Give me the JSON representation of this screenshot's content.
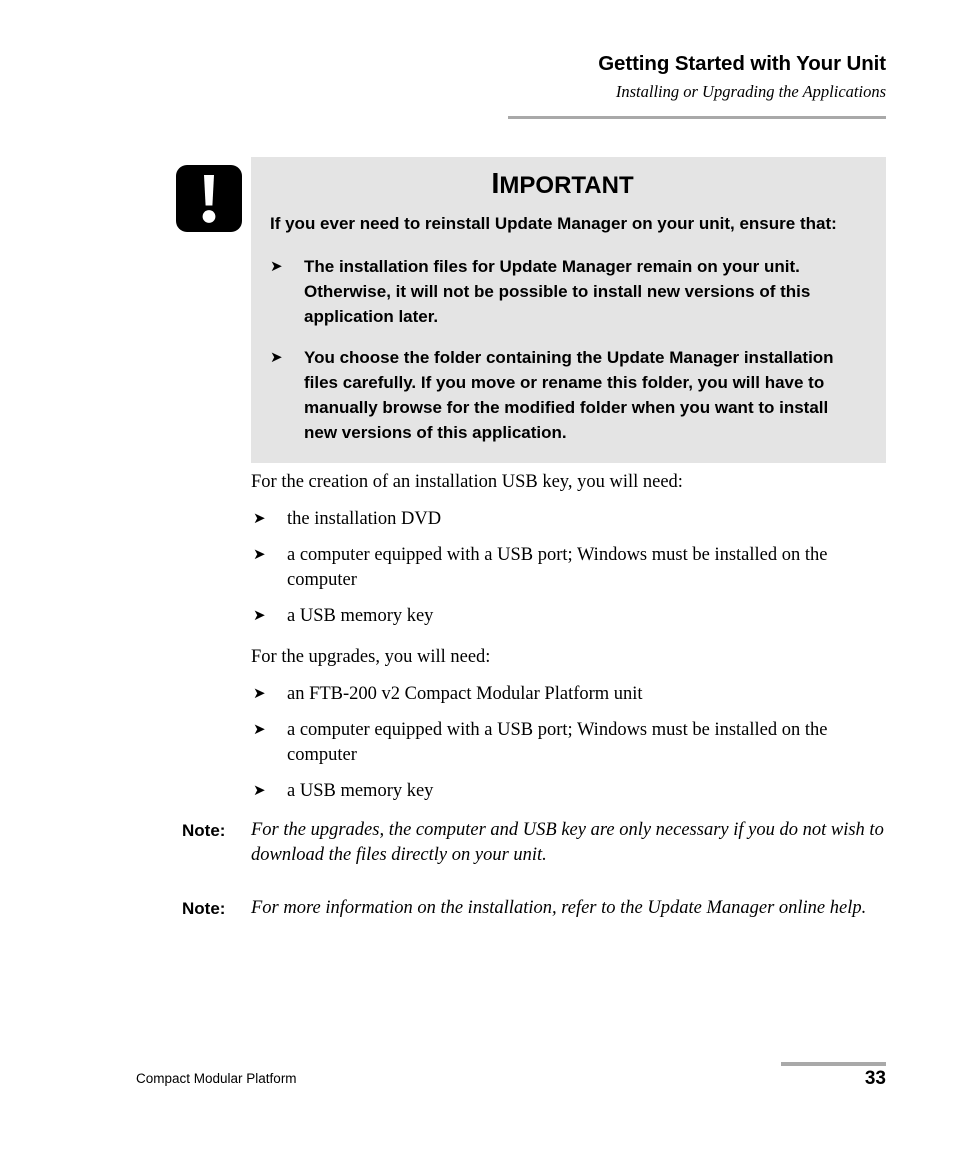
{
  "header": {
    "title": "Getting Started with Your Unit",
    "subtitle": "Installing or Upgrading the Applications"
  },
  "callout": {
    "icon": "exclamation-mark-icon",
    "title_cap": "I",
    "title_rest": "MPORTANT",
    "intro": "If you ever need to reinstall Update Manager on your unit, ensure that:",
    "bullet_glyph": "➤",
    "items": [
      "The installation files for Update Manager remain on your unit. Otherwise, it will not be possible to install new versions of this application later.",
      "You choose the folder containing the Update Manager installation files carefully. If you move or rename this folder, you will have to manually browse for the modified folder when you want to install new versions of this application."
    ]
  },
  "body": {
    "bullet_glyph": "➤",
    "creation_intro": "For the creation of an installation USB key, you will need:",
    "creation_items": [
      "the installation DVD",
      "a computer equipped with a USB port; Windows must be installed on the computer",
      "a USB memory key"
    ],
    "upgrades_intro": "For the upgrades, you will need:",
    "upgrades_items": [
      "an FTB-200 v2 Compact Modular Platform unit",
      "a computer equipped with a USB port; Windows must be installed on the computer",
      "a USB memory key"
    ]
  },
  "notes": [
    {
      "label": "Note:",
      "text": "For the upgrades, the computer and USB key are only necessary if you do not wish to download the files directly on your unit."
    },
    {
      "label": "Note:",
      "text": "For more information on the installation, refer to the Update Manager online help."
    }
  ],
  "footer": {
    "product": "Compact Modular Platform",
    "page_number": "33"
  },
  "colors": {
    "callout_background": "#e4e4e4",
    "rule": "#a9a9a9",
    "text": "#000000"
  }
}
